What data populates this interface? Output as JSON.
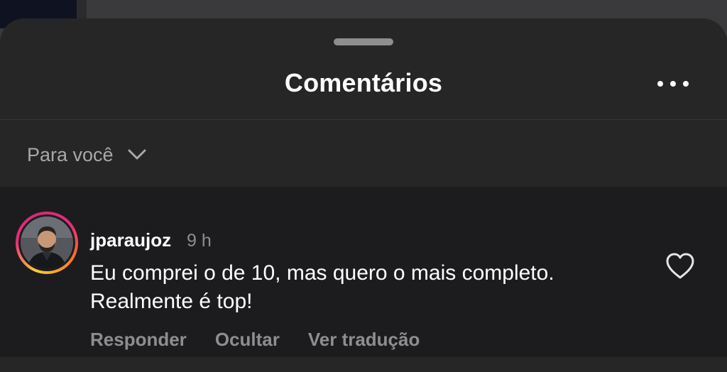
{
  "sheet": {
    "title": "Comentários",
    "more_icon": "more-horizontal-icon"
  },
  "sort": {
    "label": "Para você",
    "icon": "chevron-down-icon"
  },
  "comment": {
    "username": "jparaujoz",
    "time": "9 h",
    "text": "Eu comprei o de 10, mas quero o mais completo. Realmente é top!",
    "like_icon": "heart-icon",
    "actions": {
      "reply": "Responder",
      "hide": "Ocultar",
      "translate": "Ver tradução"
    }
  },
  "colors": {
    "sheet_background": "#262626",
    "comment_background": "#1c1c1e",
    "primary_text": "#ffffff",
    "secondary_text": "#8e8e8e"
  }
}
